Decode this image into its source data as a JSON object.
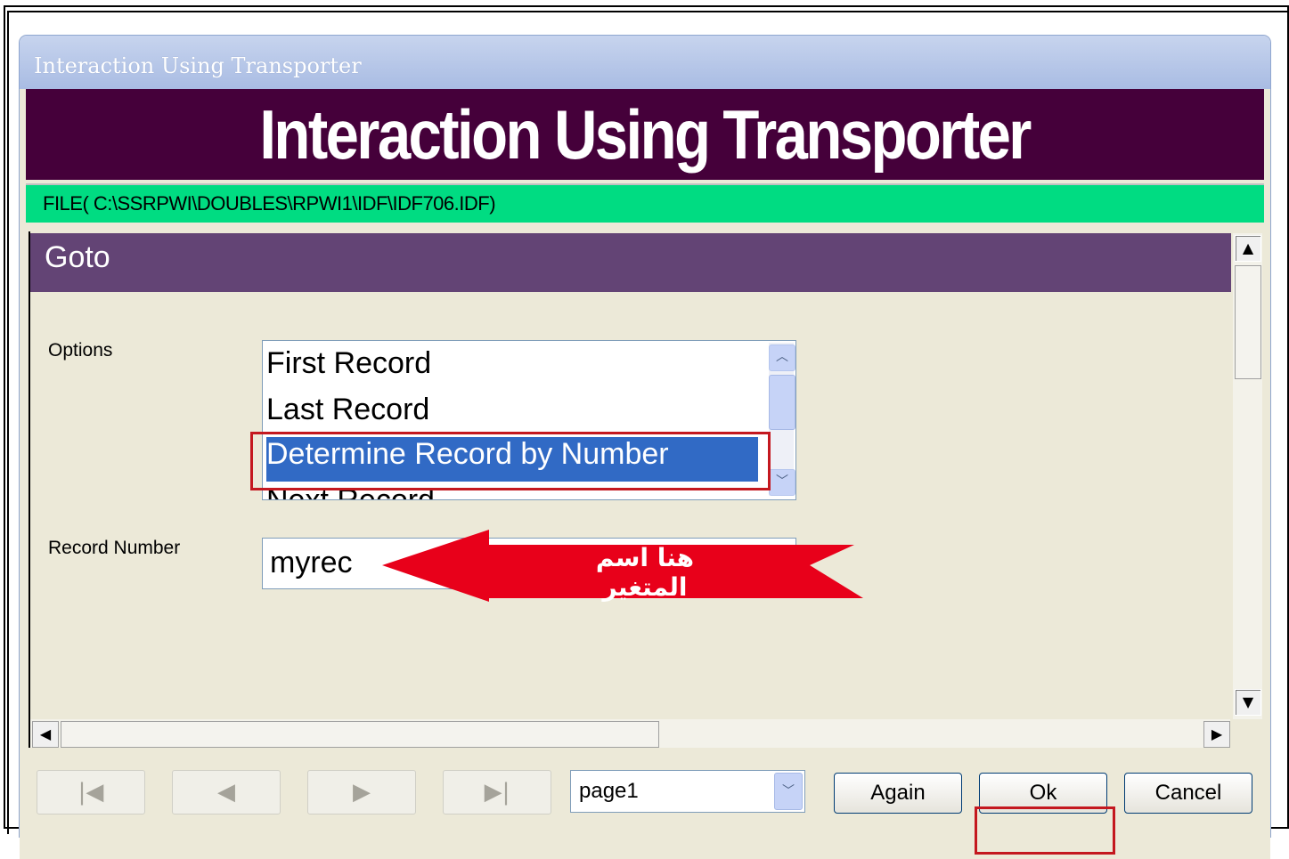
{
  "window": {
    "title": "Interaction Using Transporter"
  },
  "banner": {
    "title": "Interaction Using Transporter"
  },
  "file_bar": {
    "text": "FILE( C:\\SSRPWI\\DOUBLES\\RPWI1\\IDF\\IDF706.IDF)"
  },
  "panel": {
    "header": "Goto",
    "options_label": "Options",
    "options": [
      {
        "label": "First Record",
        "selected": false
      },
      {
        "label": "Last Record",
        "selected": false
      },
      {
        "label": "Determine Record by Number",
        "selected": true
      },
      {
        "label": "Next Record",
        "selected": false
      }
    ],
    "record_number_label": "Record Number",
    "record_number_value": "myrec"
  },
  "annotation": {
    "arrow_text": "هنا اسم المتغير",
    "arrow_color": "#e8001a",
    "highlight_color": "#c4181f"
  },
  "bottom": {
    "nav_first_icon": "first-record-icon",
    "nav_prev_icon": "previous-icon",
    "nav_next_icon": "next-icon",
    "nav_last_icon": "last-record-icon",
    "page_select_value": "page1",
    "again_label": "Again",
    "ok_label": "Ok",
    "cancel_label": "Cancel"
  }
}
